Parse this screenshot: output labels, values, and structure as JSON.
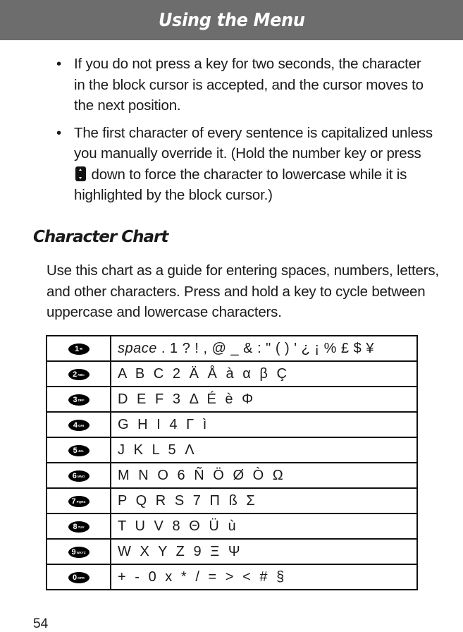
{
  "header": {
    "title": "Using the Menu"
  },
  "bullets": [
    {
      "text": "If you do not press a key for two seconds, the character in the block cursor is accepted, and the cursor moves to the next position."
    },
    {
      "text_before": "The first character of every sentence is capitalized unless you manually override it. (Hold the number key or press",
      "icon": "nav-key-icon",
      "text_after": "down to force the character to lowercase while it is highlighted by the block cursor.)"
    }
  ],
  "bullet_symbol": "•",
  "section": {
    "title": "Character Chart",
    "intro": "Use this chart as a guide for entering spaces, numbers, letters, and other characters. Press and hold a key to cycle between uppercase and lowercase characters."
  },
  "chart": {
    "rows": [
      {
        "key": "1",
        "key_letters": "✉",
        "space_label": "space",
        "chars": " . 1 ? ! , @ _ & : \" ( ) ' ¿ ¡ % £ $ ¥"
      },
      {
        "key": "2",
        "key_letters": "ABC",
        "space_label": "",
        "chars": "A  B  C  2  Ä  Å  à  α  β  Ç"
      },
      {
        "key": "3",
        "key_letters": "DEF",
        "space_label": "",
        "chars": "D  E  F  3  Δ  É  è  Φ"
      },
      {
        "key": "4",
        "key_letters": "GHI",
        "space_label": "",
        "chars": "G  H  I  4  Γ  ì"
      },
      {
        "key": "5",
        "key_letters": "JKL",
        "space_label": "",
        "chars": "J  K  L  5  Λ"
      },
      {
        "key": "6",
        "key_letters": "MNO",
        "space_label": "",
        "chars": "M  N  O  6  Ñ  Ö  Ø  Ò  Ω"
      },
      {
        "key": "7",
        "key_letters": "PQRS",
        "space_label": "",
        "chars": "P  Q  R  S  7  Π  ß  Σ"
      },
      {
        "key": "8",
        "key_letters": "TUV",
        "space_label": "",
        "chars": "T  U  V  8  Θ  Ü  ù"
      },
      {
        "key": "9",
        "key_letters": "WXYZ",
        "space_label": "",
        "chars": "W  X  Y  Z  9  Ξ  Ψ"
      },
      {
        "key": "0",
        "key_letters": "OPR",
        "space_label": "",
        "chars": "+  -  0  x  *  /  =  >  <  #  §"
      }
    ]
  },
  "page_number": "54"
}
